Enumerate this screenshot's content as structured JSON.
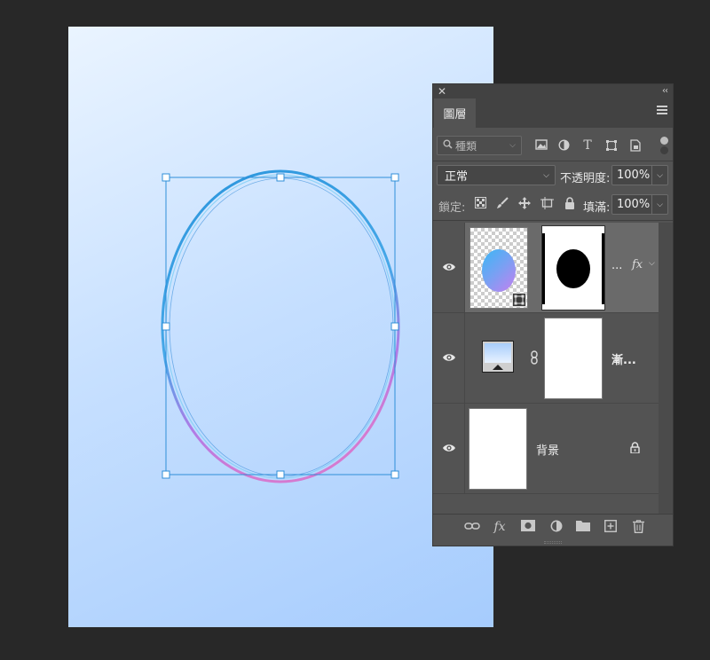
{
  "canvas": {
    "gradient_colors": [
      "#eaf4ff",
      "#a6ccfd"
    ],
    "ring_colors": [
      "#3aa0e0",
      "#c77ae0"
    ]
  },
  "panel": {
    "close_icon": "close-icon",
    "collapse_label": "‹‹",
    "tab_label": "圖層",
    "filter": {
      "placeholder": "種類",
      "icons": [
        "image-filter-icon",
        "adjustment-filter-icon",
        "type-filter-icon",
        "shape-filter-icon",
        "smart-object-filter-icon"
      ]
    },
    "blend": {
      "mode": "正常",
      "opacity_label": "不透明度:",
      "opacity_value": "100%"
    },
    "lock": {
      "label": "鎖定:",
      "fill_label": "填滿:",
      "fill_value": "100%",
      "icons": [
        "lock-transparent-icon",
        "lock-paint-icon",
        "lock-position-icon",
        "lock-artboard-icon",
        "lock-all-icon"
      ]
    },
    "layers": [
      {
        "name": "...",
        "fx": "fx",
        "visible": true,
        "selected": true
      },
      {
        "name": "漸...",
        "visible": true
      },
      {
        "name": "背景",
        "visible": true,
        "locked": true
      }
    ],
    "footer_icons": [
      "link-icon",
      "fx-icon",
      "mask-icon",
      "adjustment-icon",
      "folder-icon",
      "new-layer-icon",
      "trash-icon"
    ],
    "fx_label": "fx"
  }
}
